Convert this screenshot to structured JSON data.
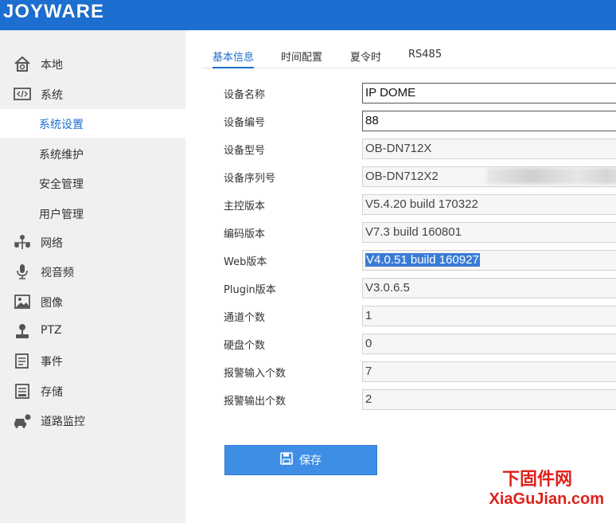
{
  "brand": {
    "logo_text": "JOYWARE",
    "accent": "#1c6fd0"
  },
  "sidebar": {
    "items": [
      {
        "label": "本地",
        "icon": "house-icon"
      },
      {
        "label": "系统",
        "icon": "code-window-icon"
      },
      {
        "label": "系统设置",
        "active": true
      },
      {
        "label": "系统维护"
      },
      {
        "label": "安全管理"
      },
      {
        "label": "用户管理"
      },
      {
        "label": "网络",
        "icon": "network-icon"
      },
      {
        "label": "视音频",
        "icon": "microphone-icon"
      },
      {
        "label": "图像",
        "icon": "image-icon"
      },
      {
        "label": "PTZ",
        "icon": "joystick-icon"
      },
      {
        "label": "事件",
        "icon": "event-list-icon"
      },
      {
        "label": "存储",
        "icon": "storage-icon"
      },
      {
        "label": "道路监控",
        "icon": "car-camera-icon"
      }
    ]
  },
  "tabs": [
    {
      "label": "基本信息",
      "active": true
    },
    {
      "label": "时间配置"
    },
    {
      "label": "夏令时"
    },
    {
      "label": "RS485"
    }
  ],
  "form": [
    {
      "label": "设备名称",
      "value": "IP DOME",
      "editable": true
    },
    {
      "label": "设备编号",
      "value": "88",
      "editable": true
    },
    {
      "label": "设备型号",
      "value": "OB-DN712X"
    },
    {
      "label": "设备序列号",
      "value": "OB-DN712X2",
      "obscured": true
    },
    {
      "label": "主控版本",
      "value": "V5.4.20 build 170322"
    },
    {
      "label": "编码版本",
      "value": "V7.3 build 160801"
    },
    {
      "label": "Web版本",
      "value": "V4.0.51 build 160927",
      "selected": true
    },
    {
      "label": "Plugin版本",
      "value": "V3.0.6.5"
    },
    {
      "label": "通道个数",
      "value": "1"
    },
    {
      "label": "硬盘个数",
      "value": "0"
    },
    {
      "label": "报警输入个数",
      "value": "7"
    },
    {
      "label": "报警输出个数",
      "value": "2"
    }
  ],
  "save_button": {
    "label": "保存",
    "icon": "floppy-disk-icon"
  },
  "watermark": {
    "line1": "下固件网",
    "line2": "XiaGuJian.com"
  }
}
